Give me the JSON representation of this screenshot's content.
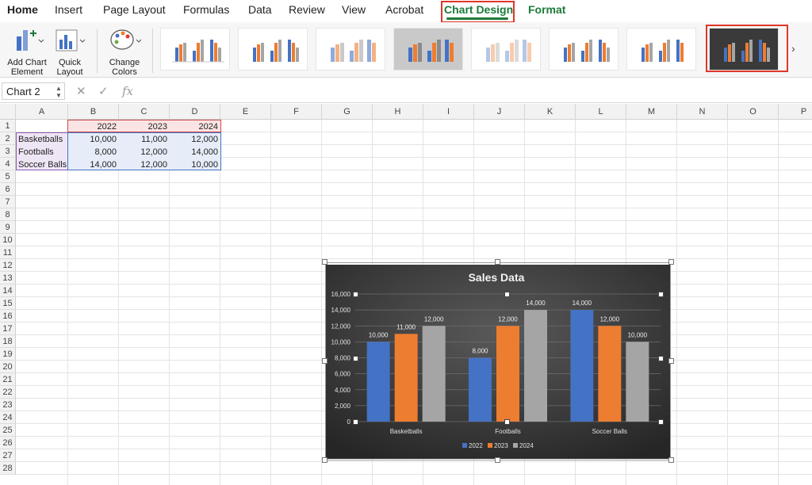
{
  "ribbon": {
    "tabs": [
      "Home",
      "Insert",
      "Page Layout",
      "Formulas",
      "Data",
      "Review",
      "View",
      "Acrobat",
      "Chart Design",
      "Format"
    ],
    "active_tab": "Chart Design",
    "add_chart_element": [
      "Add Chart",
      "Element"
    ],
    "quick_layout": [
      "Quick",
      "Layout"
    ],
    "change_colors": [
      "Change",
      "Colors"
    ]
  },
  "formula_bar": {
    "name_box": "Chart 2",
    "fx": "fx"
  },
  "sheet": {
    "columns": [
      "A",
      "B",
      "C",
      "D",
      "E",
      "F",
      "G",
      "H",
      "I",
      "J",
      "K",
      "L",
      "M",
      "N",
      "O",
      "P"
    ],
    "rows": [
      "1",
      "2",
      "3",
      "4",
      "5",
      "6",
      "7",
      "8",
      "9",
      "10",
      "11",
      "12",
      "13",
      "14",
      "15",
      "16",
      "17",
      "18",
      "19",
      "20",
      "21",
      "22",
      "23",
      "24",
      "25",
      "26",
      "27",
      "28"
    ],
    "headers": [
      "2022",
      "2023",
      "2024"
    ],
    "data": [
      {
        "label": "Basketballs",
        "values": [
          "10,000",
          "11,000",
          "12,000"
        ]
      },
      {
        "label": "Footballs",
        "values": [
          "8,000",
          "12,000",
          "14,000"
        ]
      },
      {
        "label": "Soccer Balls",
        "values": [
          "14,000",
          "12,000",
          "10,000"
        ]
      }
    ]
  },
  "colors": {
    "accent_green": "#1d7a3b",
    "highlight_red": "#e0372a",
    "series_2022": "#4472c4",
    "series_2023": "#ed7d31",
    "series_2024": "#a5a5a5"
  },
  "chart_data": {
    "type": "bar",
    "title": "Sales Data",
    "categories": [
      "Basketballs",
      "Footballs",
      "Soccer Balls"
    ],
    "series": [
      {
        "name": "2022",
        "values": [
          10000,
          8000,
          14000
        ]
      },
      {
        "name": "2023",
        "values": [
          11000,
          12000,
          12000
        ]
      },
      {
        "name": "2024",
        "values": [
          12000,
          14000,
          10000
        ]
      }
    ],
    "data_labels": [
      [
        "10,000",
        "8,000",
        "14,000"
      ],
      [
        "11,000",
        "12,000",
        "12,000"
      ],
      [
        "12,000",
        "14,000",
        "10,000"
      ]
    ],
    "ylim": [
      0,
      16000
    ],
    "yticks": [
      "0",
      "2,000",
      "4,000",
      "6,000",
      "8,000",
      "10,000",
      "12,000",
      "14,000",
      "16,000"
    ],
    "legend_position": "bottom",
    "grid": true,
    "style": "dark"
  }
}
